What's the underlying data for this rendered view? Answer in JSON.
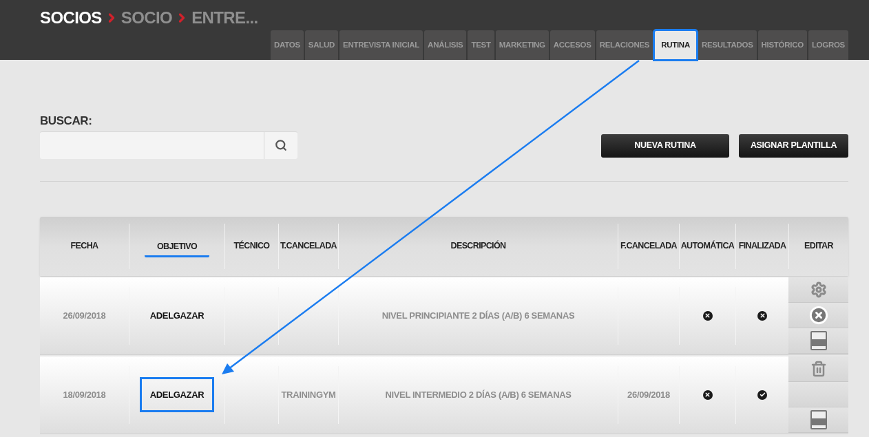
{
  "breadcrumb": [
    "SOCIOS",
    "SOCIO",
    "ENTRE..."
  ],
  "tabs": [
    {
      "label": "DATOS",
      "selected": false,
      "highlighted": false
    },
    {
      "label": "SALUD",
      "selected": false,
      "highlighted": false
    },
    {
      "label": "ENTREVISTA INICIAL",
      "selected": false,
      "highlighted": false
    },
    {
      "label": "ANÁLISIS",
      "selected": false,
      "highlighted": false
    },
    {
      "label": "TEST",
      "selected": false,
      "highlighted": false
    },
    {
      "label": "MARKETING",
      "selected": false,
      "highlighted": false
    },
    {
      "label": "ACCESOS",
      "selected": false,
      "highlighted": false
    },
    {
      "label": "RELACIONES",
      "selected": false,
      "highlighted": false
    },
    {
      "label": "RUTINA",
      "selected": true,
      "highlighted": true
    },
    {
      "label": "RESULTADOS",
      "selected": false,
      "highlighted": false
    },
    {
      "label": "HISTÓRICO",
      "selected": false,
      "highlighted": false
    },
    {
      "label": "LOGROS",
      "selected": false,
      "highlighted": false
    }
  ],
  "search": {
    "label": "BUSCAR:"
  },
  "buttons": [
    "NUEVA RUTINA",
    "ASIGNAR PLANTILLA"
  ],
  "table": {
    "columns": [
      {
        "label": "FECHA",
        "underlined": false
      },
      {
        "label": "OBJETIVO",
        "underlined": true
      },
      {
        "label": "TÉCNICO",
        "underlined": false
      },
      {
        "label": "T.CANCELADA",
        "underlined": false
      },
      {
        "label": "DESCRIPCIÓN",
        "underlined": false
      },
      {
        "label": "F.CANCELADA",
        "underlined": false
      },
      {
        "label": "AUTOMÁTICA",
        "underlined": false
      },
      {
        "label": "FINALIZADA",
        "underlined": false
      },
      {
        "label": "EDITAR",
        "underlined": false
      }
    ],
    "rows": [
      {
        "fecha": "26/09/2018",
        "objetivo": "ADELGAZAR",
        "objetivo_highlighted": false,
        "tecnico": "",
        "t_cancelada": "",
        "descripcion": "NIVEL PRINCIPIANTE 2 DÍAS (A/B) 6 SEMANAS",
        "f_cancelada": "",
        "automatica": false,
        "finalizada": false,
        "actions": [
          {
            "kind": "settings"
          },
          {
            "kind": "cancel"
          },
          {
            "kind": "pdf"
          }
        ]
      },
      {
        "fecha": "18/09/2018",
        "objetivo": "ADELGAZAR",
        "objetivo_highlighted": true,
        "tecnico": "",
        "t_cancelada": "TRAININGYM",
        "descripcion": "NIVEL INTERMEDIO 2 DÍAS (A/B) 6 SEMANAS",
        "f_cancelada": "26/09/2018",
        "automatica": false,
        "finalizada": true,
        "actions": [
          {
            "kind": "delete"
          },
          {
            "kind": "empty"
          },
          {
            "kind": "pdf"
          }
        ]
      }
    ]
  }
}
